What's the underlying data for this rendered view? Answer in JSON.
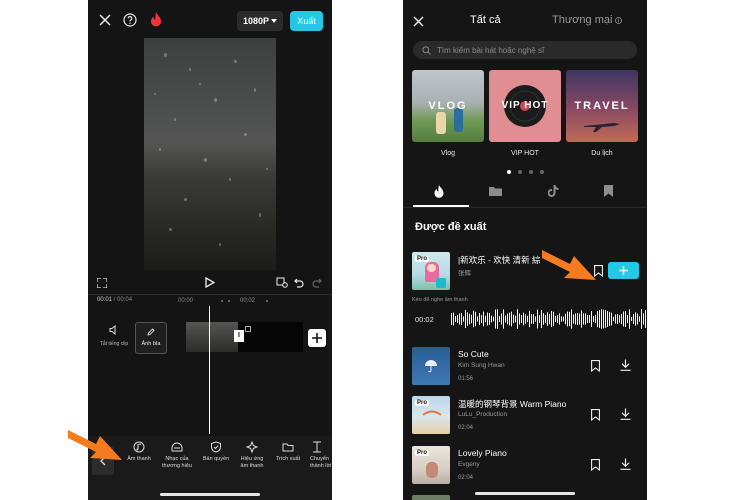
{
  "editor": {
    "resolution": "1080P",
    "export_label": "Xuất",
    "time_current": "00:01",
    "time_total": "/ 00:04",
    "ruler": [
      "00:00",
      "00:02"
    ],
    "mute_label": "Tắt tiếng clip",
    "cover_label": "Ảnh bìa",
    "clip_badge": "I",
    "tools": [
      {
        "label": "Âm thanh",
        "icon": "music-note-icon"
      },
      {
        "label": "Nhạc của thương hiệu",
        "icon": "brand-music-icon"
      },
      {
        "label": "Bản quyền",
        "icon": "shield-check-icon"
      },
      {
        "label": "Hiệu ứng âm thanh",
        "icon": "sparkle-icon"
      },
      {
        "label": "Trích xuất",
        "icon": "folder-icon"
      },
      {
        "label": "Chuyển thành lời",
        "icon": "text-convert-icon"
      }
    ]
  },
  "library": {
    "tabs": {
      "all": "Tất cả",
      "commercial": "Thương mại"
    },
    "search_placeholder": "Tìm kiếm bài hát hoặc nghệ sĩ",
    "categories": [
      {
        "title": "VLOG",
        "caption": "Vlog"
      },
      {
        "title": "VIP HOT",
        "caption": "VIP HOT"
      },
      {
        "title": "TRAVEL",
        "caption": "Du lịch"
      }
    ],
    "section_title": "Được đề xuất",
    "preview_hint": "Kéo để nghe âm thanh",
    "preview_time": "00:02",
    "songs": [
      {
        "title": "|新欢乐 - 欢快 清新 綜",
        "artist": "张辉",
        "duration": "",
        "pro": "Pro"
      },
      {
        "title": "So Cute",
        "artist": "Kim Sung Hwan",
        "duration": "01:56",
        "pro": ""
      },
      {
        "title": "温暖的钢琴背景  Warm Piano",
        "artist": "LuLu_Production",
        "duration": "02:04",
        "pro": "Pro"
      },
      {
        "title": "Lovely Piano",
        "artist": "Evgeny",
        "duration": "02:04",
        "pro": "Pro"
      }
    ]
  },
  "colors": {
    "accent": "#22c8e6",
    "pointer": "#f47b20",
    "background": "#141414"
  }
}
